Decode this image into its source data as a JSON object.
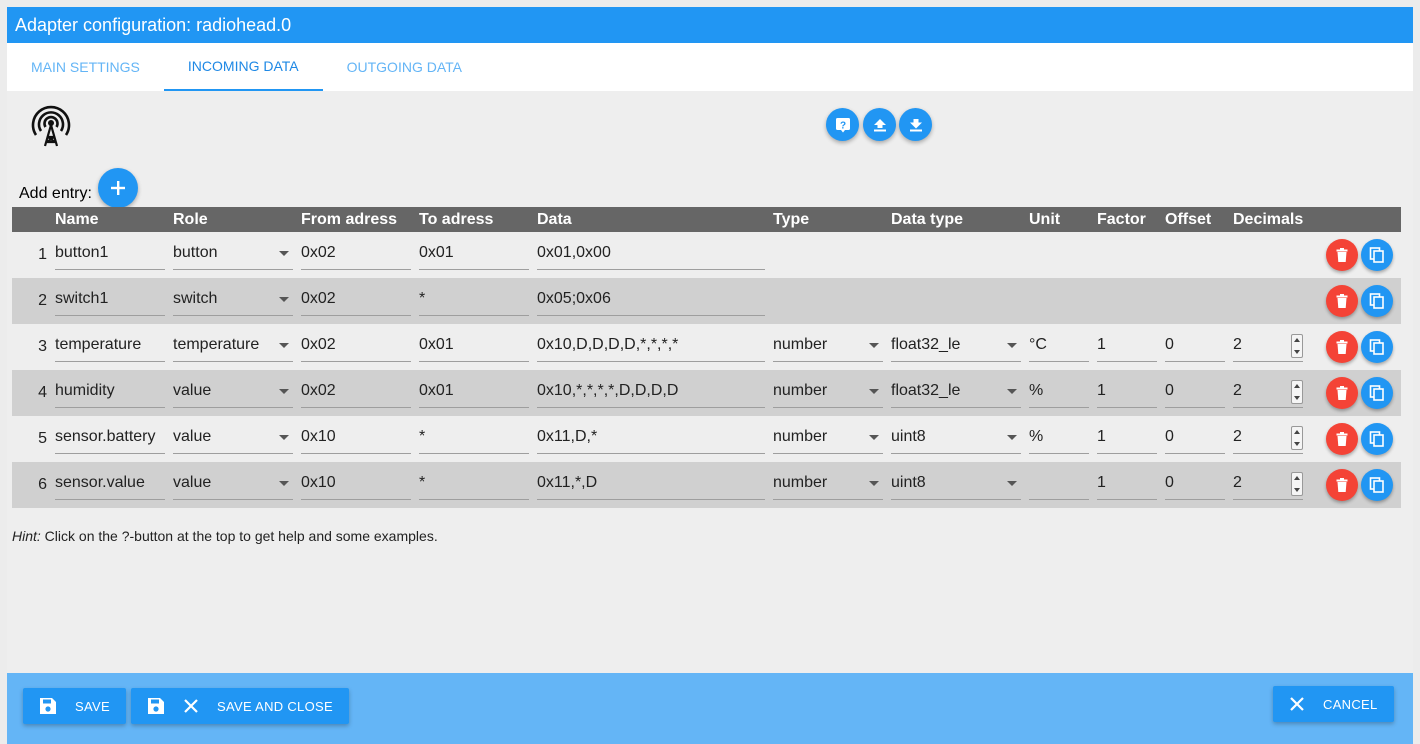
{
  "window": {
    "title": "Adapter configuration: radiohead.0"
  },
  "tabs": [
    {
      "label": "MAIN SETTINGS",
      "active": false
    },
    {
      "label": "INCOMING DATA",
      "active": true
    },
    {
      "label": "OUTGOING DATA",
      "active": false
    }
  ],
  "toolbar": {
    "icons": [
      "antenna-icon",
      "help-icon",
      "upload-icon",
      "download-icon"
    ]
  },
  "add_entry": {
    "label": "Add entry:"
  },
  "table": {
    "columns": [
      "Name",
      "Role",
      "From adress",
      "To adress",
      "Data",
      "Type",
      "Data type",
      "Unit",
      "Factor",
      "Offset",
      "Decimals"
    ],
    "rows": [
      {
        "num": "1",
        "name": "button1",
        "role": "button",
        "from": "0x02",
        "to": "0x01",
        "data": "0x01,0x00",
        "type": "",
        "datatype": "",
        "unit": "",
        "factor": "",
        "offset": "",
        "decimals": ""
      },
      {
        "num": "2",
        "name": "switch1",
        "role": "switch",
        "from": "0x02",
        "to": "*",
        "data": "0x05;0x06",
        "type": "",
        "datatype": "",
        "unit": "",
        "factor": "",
        "offset": "",
        "decimals": ""
      },
      {
        "num": "3",
        "name": "temperature",
        "role": "temperature",
        "from": "0x02",
        "to": "0x01",
        "data": "0x10,D,D,D,D,*,*,*,*",
        "type": "number",
        "datatype": "float32_le",
        "unit": "°C",
        "factor": "1",
        "offset": "0",
        "decimals": "2"
      },
      {
        "num": "4",
        "name": "humidity",
        "role": "value",
        "from": "0x02",
        "to": "0x01",
        "data": "0x10,*,*,*,*,D,D,D,D",
        "type": "number",
        "datatype": "float32_le",
        "unit": "%",
        "factor": "1",
        "offset": "0",
        "decimals": "2"
      },
      {
        "num": "5",
        "name": "sensor.battery",
        "role": "value",
        "from": "0x10",
        "to": "*",
        "data": "0x11,D,*",
        "type": "number",
        "datatype": "uint8",
        "unit": "%",
        "factor": "1",
        "offset": "0",
        "decimals": "2"
      },
      {
        "num": "6",
        "name": "sensor.value",
        "role": "value",
        "from": "0x10",
        "to": "*",
        "data": "0x11,*,D",
        "type": "number",
        "datatype": "uint8",
        "unit": "",
        "factor": "1",
        "offset": "0",
        "decimals": "2"
      }
    ]
  },
  "hint": {
    "prefix": "Hint:",
    "text": " Click on the ?-button at the top to get help and some examples."
  },
  "footer": {
    "save": "SAVE",
    "save_close": "SAVE AND CLOSE",
    "cancel": "CANCEL"
  },
  "colors": {
    "primary": "#2196f3",
    "footer": "#64b5f6",
    "delete": "#f44336",
    "header": "#666666"
  }
}
